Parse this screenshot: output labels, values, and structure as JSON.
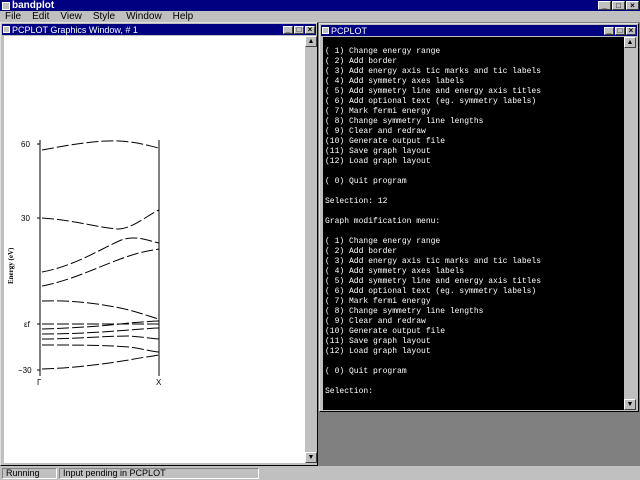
{
  "app": {
    "title": "bandplot",
    "min_glyph": "_",
    "max_glyph": "□",
    "close_glyph": "×"
  },
  "menu": [
    "File",
    "Edit",
    "View",
    "Style",
    "Window",
    "Help"
  ],
  "graphics_window": {
    "title": "PCPLOT Graphics Window, # 1",
    "y_ticks": [
      "60",
      "30",
      "εf",
      "−30"
    ],
    "y_label": "Energy (eV)",
    "x_ticks": [
      "Γ",
      "X"
    ]
  },
  "terminal_window": {
    "title": "PCPLOT",
    "lines": [
      "",
      "( 1) Change energy range",
      "( 2) Add border",
      "( 3) Add energy axis tic marks and tic labels",
      "( 4) Add symmetry axes labels",
      "( 5) Add symmetry line and energy axis titles",
      "( 6) Add optional text (eg. symmetry labels)",
      "( 7) Mark fermi energy",
      "( 8) Change symmetry line lengths",
      "( 9) Clear and redraw",
      "(10) Generate output file",
      "(11) Save graph layout",
      "(12) Load graph layout",
      "",
      "( 0) Quit program",
      "",
      "Selection: 12",
      "",
      "Graph modification menu:",
      "",
      "( 1) Change energy range",
      "( 2) Add border",
      "( 3) Add energy axis tic marks and tic labels",
      "( 4) Add symmetry axes labels",
      "( 5) Add symmetry line and energy axis titles",
      "( 6) Add optional text (eg. symmetry labels)",
      "( 7) Mark fermi energy",
      "( 8) Change symmetry line lengths",
      "( 9) Clear and redraw",
      "(10) Generate output file",
      "(11) Save graph layout",
      "(12) Load graph layout",
      "",
      "( 0) Quit program",
      "",
      "Selection:"
    ]
  },
  "status": {
    "left": "Running",
    "right": "Input pending in PCPLOT"
  }
}
